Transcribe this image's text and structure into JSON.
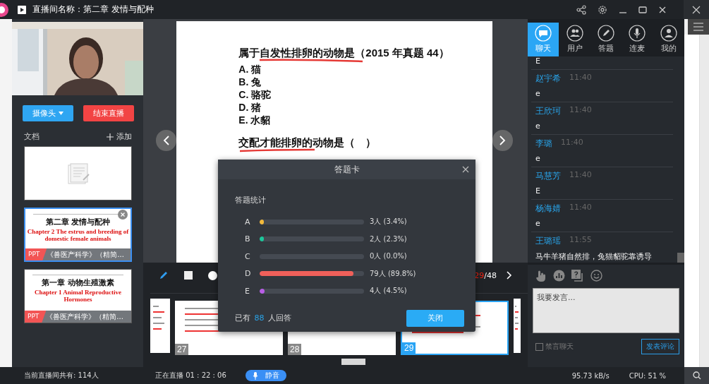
{
  "window": {
    "title": "直播间名称：第二章 发情与配种"
  },
  "controls": {
    "camera_button": "摄像头",
    "end_button": "结束直播"
  },
  "documents": {
    "title": "文档",
    "add_button": "添加",
    "items": [
      {
        "kind": "blank",
        "selected": false
      },
      {
        "kind": "ppt",
        "selected": true,
        "heading": "第二章  发情与配种",
        "subtitle": "Chapter 2   The estrus and breeding of domestic female animals",
        "badge": "PPT",
        "caption": "《兽医产科学》（精简..."
      },
      {
        "kind": "ppt",
        "selected": false,
        "heading": "第一章  动物生殖激素",
        "subtitle": "Chapter 1   Animal Reproductive Hormones",
        "badge": "PPT",
        "caption": "《兽医产科学》（精简..."
      }
    ]
  },
  "slide": {
    "question": "属于自发性排卵的动物是（2015 年真题 44）",
    "options": [
      "A. 猫",
      "B. 兔",
      "C. 骆驼",
      "D. 猪",
      "E. 水貂"
    ],
    "question_2": "交配才能排卵的动物是（　）"
  },
  "toolbar": {
    "page_current": "29",
    "page_total": "/48"
  },
  "thumbnails": [
    {
      "kind": "partial",
      "selected": false
    },
    {
      "kind": "slide",
      "number": "27",
      "selected": false
    },
    {
      "kind": "slide",
      "number": "28",
      "selected": false
    },
    {
      "kind": "slide",
      "number": "29",
      "selected": true
    },
    {
      "kind": "partial",
      "selected": false
    }
  ],
  "answer_card": {
    "title": "答题卡",
    "section": "答题统计",
    "rows": [
      {
        "label": "A",
        "level": 0.034,
        "reading": "3人 (3.4%)",
        "color": "#f2b93b"
      },
      {
        "label": "B",
        "level": 0.023,
        "reading": "2人 (2.3%)",
        "color": "#1cc79b"
      },
      {
        "label": "C",
        "reading": "0人 (0.0%)"
      },
      {
        "label": "D",
        "level": 0.898,
        "reading": "79人 (89.8%)",
        "color": "#f0605a"
      },
      {
        "label": "E",
        "level": 0.045,
        "reading": "4人 (4.5%)",
        "color": "#b85ee6"
      }
    ],
    "summary_prefix": "已有",
    "count": "88",
    "summary_suffix": "人回答",
    "button": "关闭"
  },
  "chat": {
    "tabs": [
      {
        "label": "聊天",
        "selected": true
      },
      {
        "label": "用户",
        "selected": false
      },
      {
        "label": "答题",
        "selected": false
      },
      {
        "label": "连麦",
        "selected": false
      },
      {
        "label": "我的",
        "selected": false
      }
    ],
    "messages": [
      {
        "text": "E"
      },
      {
        "name": "赵宇希",
        "time": "11:40",
        "text": "e"
      },
      {
        "name": "王欣珂",
        "time": "11:40",
        "text": "e"
      },
      {
        "name": "李璐",
        "time": "11:40",
        "text": "e"
      },
      {
        "name": "马慧芳",
        "time": "11:40",
        "text": "E"
      },
      {
        "name": "杨海婧",
        "time": "11:40",
        "text": "e"
      },
      {
        "name": "王璐瑶",
        "time": "11:55",
        "text": "马牛羊猪自然排，兔猫貂驼靠诱导"
      }
    ],
    "input_placeholder": "我要发言...",
    "mute_label": "禁言聊天",
    "mute_checked": false,
    "send_button": "发表评论"
  },
  "status_bar": {
    "viewers": "当前直播间共有: 114人",
    "live": "正在直播 01 : 22 : 06",
    "mute_button": "静音",
    "speed": "95.73 kB/s",
    "cpu": "CPU:  51 %"
  }
}
